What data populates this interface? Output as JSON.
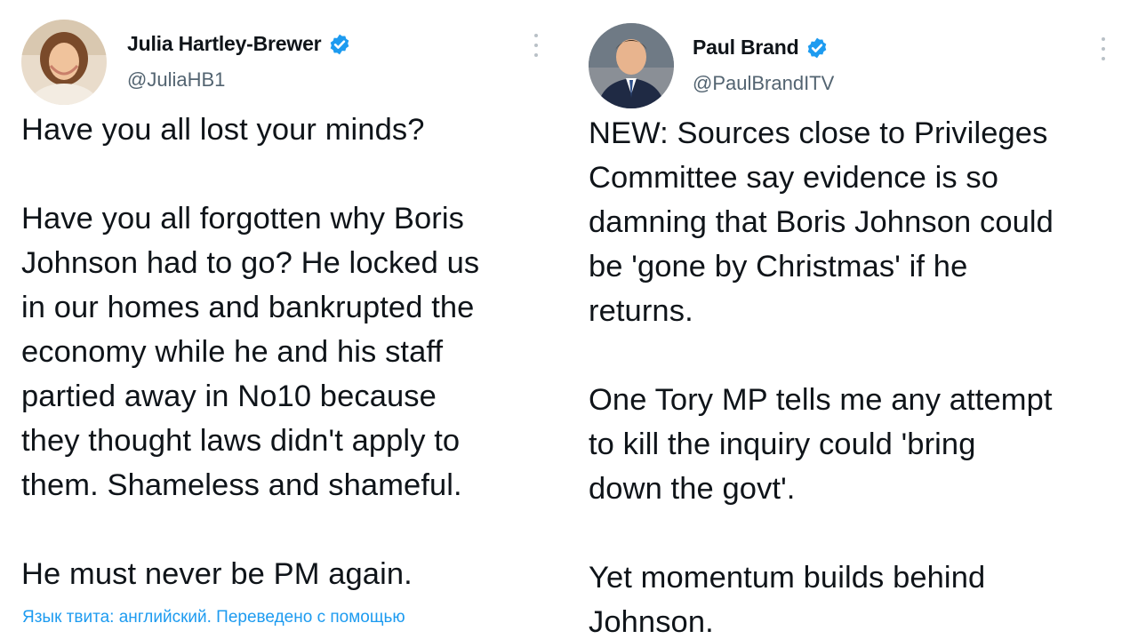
{
  "colors": {
    "link": "#1d9bf0",
    "verified": "#1d9bf0",
    "muted": "#536471",
    "text": "#0f1419"
  },
  "tweets": [
    {
      "author": {
        "name": "Julia Hartley-Brewer",
        "handle": "@JuliaHB1",
        "verified": true,
        "avatar_icon": "avatar-photo-icon"
      },
      "paragraphs": [
        "Have you all lost your minds?",
        "Have you all forgotten why Boris\nJohnson had to go? He locked us\nin our homes and bankrupted the\neconomy while he and his staff\npartied away in No10 because\nthey thought laws didn't apply to\nthem. Shameless and shameful.",
        "He must never be PM again."
      ],
      "translation_note": "Язык твита: английский. Переведено с помощью"
    },
    {
      "author": {
        "name": "Paul Brand",
        "handle": "@PaulBrandITV",
        "verified": true,
        "avatar_icon": "avatar-photo-icon"
      },
      "paragraphs": [
        "NEW: Sources close to Privileges\nCommittee say evidence is so\ndamning that Boris Johnson could\nbe 'gone by Christmas' if he\nreturns.",
        "One Tory MP tells me any attempt\nto kill the inquiry could 'bring\ndown the govt'.",
        "Yet momentum builds behind\nJohnson."
      ]
    }
  ]
}
